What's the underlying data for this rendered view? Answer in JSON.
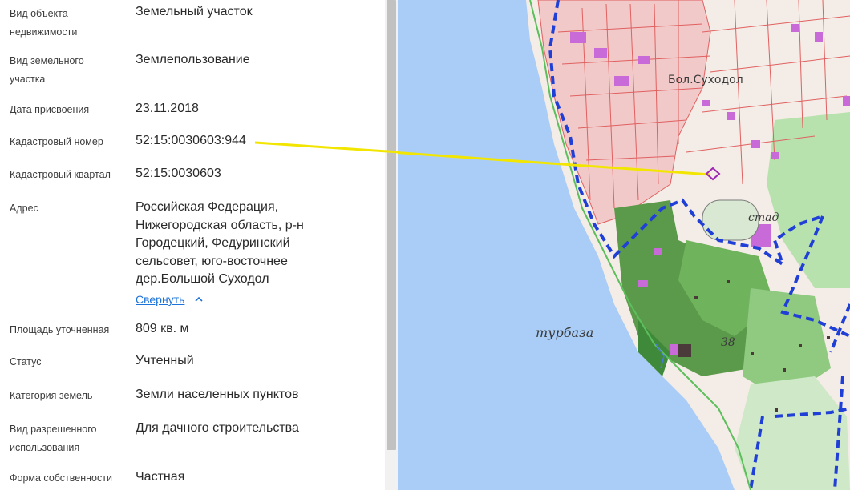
{
  "fields": [
    {
      "label": "Вид объекта недвижимости",
      "value": "Земельный участок"
    },
    {
      "label": "Вид земельного участка",
      "value": "Землепользование"
    },
    {
      "label": "Дата присвоения",
      "value": "23.11.2018"
    },
    {
      "label": "Кадастровый номер",
      "value": "52:15:0030603:944"
    },
    {
      "label": "Кадастровый квартал",
      "value": "52:15:0030603"
    },
    {
      "label": "Адрес",
      "value": "Российская Федерация, Нижегородская область, р-н Городецкий, Федуринский сельсовет, юго-восточнее дер.Большой Суходол"
    },
    {
      "label": "Площадь уточненная",
      "value": "809 кв. м"
    },
    {
      "label": "Статус",
      "value": "Учтенный"
    },
    {
      "label": "Категория земель",
      "value": "Земли населенных пунктов"
    },
    {
      "label": "Вид разрешенного использования",
      "value": "Для дачного строительства"
    },
    {
      "label": "Форма собственности",
      "value": "Частная"
    }
  ],
  "address_toggle": "Свернуть",
  "map": {
    "labels": {
      "village": "Бол.Суходол",
      "stadium": "стад",
      "camp": "турбаза",
      "number": "38"
    },
    "colors": {
      "water": "#a9cdf7",
      "pointer_line": "#f2e600",
      "boundary": "#1f3fd6",
      "parcel_outline": "#e06060",
      "forest": "#3f8a3a",
      "building": "#c86ad8"
    }
  }
}
